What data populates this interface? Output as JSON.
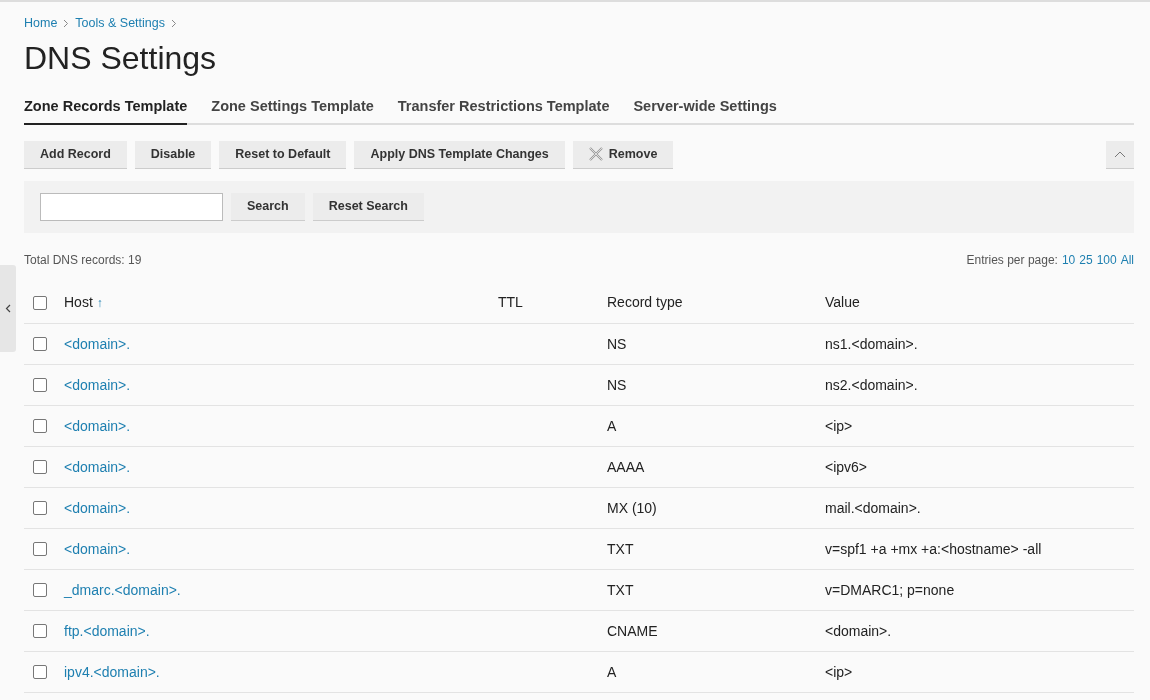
{
  "breadcrumb": [
    "Home",
    "Tools & Settings"
  ],
  "title": "DNS Settings",
  "tabs": [
    {
      "label": "Zone Records Template",
      "selected": true
    },
    {
      "label": "Zone Settings Template",
      "selected": false
    },
    {
      "label": "Transfer Restrictions Template",
      "selected": false
    },
    {
      "label": "Server-wide Settings",
      "selected": false
    }
  ],
  "toolbar": [
    {
      "label": "Add Record",
      "kind": "plain"
    },
    {
      "label": "Disable",
      "kind": "plain"
    },
    {
      "label": "Reset to Default",
      "kind": "plain"
    },
    {
      "label": "Apply DNS Template Changes",
      "kind": "plain"
    },
    {
      "label": "Remove",
      "kind": "remove"
    }
  ],
  "search": {
    "buttons": [
      "Search",
      "Reset Search"
    ]
  },
  "total": "Total DNS records: 19",
  "entries": {
    "label": "Entries per page:",
    "options": [
      "10",
      "25",
      "100",
      "All"
    ]
  },
  "table": {
    "select_all_checked": false,
    "columns": [
      {
        "label": "Host",
        "sort_indicator": "↑"
      },
      {
        "label": "TTL"
      },
      {
        "label": "Record type"
      },
      {
        "label": "Value"
      }
    ],
    "rows": [
      {
        "checked": false,
        "host": "<domain>.",
        "type": "NS",
        "value": "ns1.<domain>."
      },
      {
        "checked": false,
        "host": "<domain>.",
        "type": "NS",
        "value": "ns2.<domain>."
      },
      {
        "checked": false,
        "host": "<domain>.",
        "type": "A",
        "value": "<ip>"
      },
      {
        "checked": false,
        "host": "<domain>.",
        "type": "AAAA",
        "value": "<ipv6>"
      },
      {
        "checked": false,
        "host": "<domain>.",
        "type": "MX (10)",
        "value": "mail.<domain>."
      },
      {
        "checked": false,
        "host": "<domain>.",
        "type": "TXT",
        "value": "v=spf1 +a +mx +a:<hostname> -all"
      },
      {
        "checked": false,
        "host": "_dmarc.<domain>.",
        "type": "TXT",
        "value": "v=DMARC1; p=none"
      },
      {
        "checked": false,
        "host": "ftp.<domain>.",
        "type": "CNAME",
        "value": "<domain>."
      },
      {
        "checked": false,
        "host": "ipv4.<domain>.",
        "type": "A",
        "value": "<ip>"
      }
    ]
  }
}
